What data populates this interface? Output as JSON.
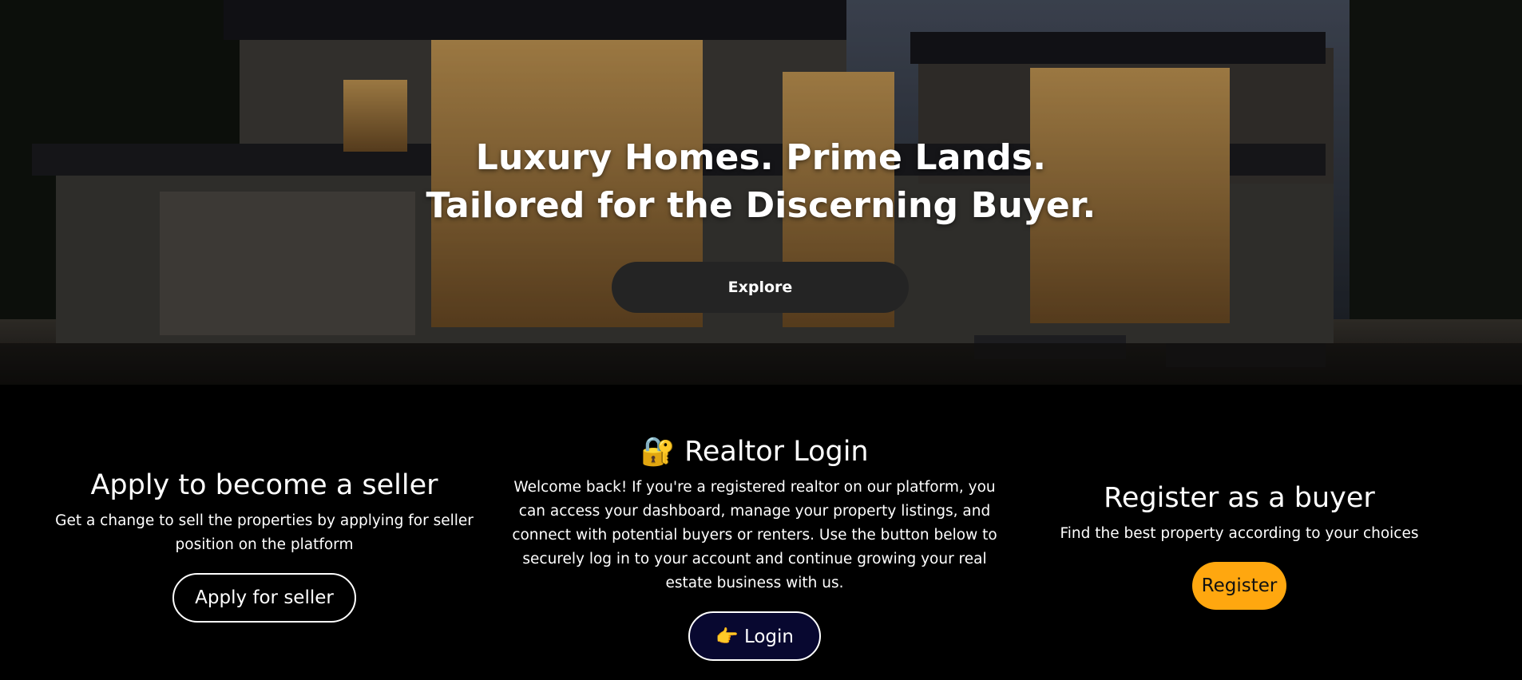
{
  "hero": {
    "title_line1": "Luxury Homes. Prime Lands.",
    "title_line2": "Tailored for the Discerning Buyer.",
    "explore_label": "Explore"
  },
  "seller": {
    "title": "Apply to become a seller",
    "description": "Get a change to sell the properties by applying for seller position on the platform",
    "button_label": "Apply for seller"
  },
  "realtor": {
    "icon": "lock-with-key-icon",
    "icon_glyph": "🔐",
    "title": "Realtor Login",
    "description": "Welcome back! If you're a registered realtor on our platform, you can access your dashboard, manage your property listings, and connect with potential buyers or renters. Use the button below to securely log in to your account and continue growing your real estate business with us.",
    "button_icon": "pointing-hand-icon",
    "button_icon_glyph": "👉",
    "button_label": "Login"
  },
  "buyer": {
    "title": "Register as a buyer",
    "description": "Find the best property according to your choices",
    "button_label": "Register"
  },
  "colors": {
    "background": "#000000",
    "explore_button": "#242424",
    "login_button": "#080830",
    "register_button": "#ffa70f"
  }
}
